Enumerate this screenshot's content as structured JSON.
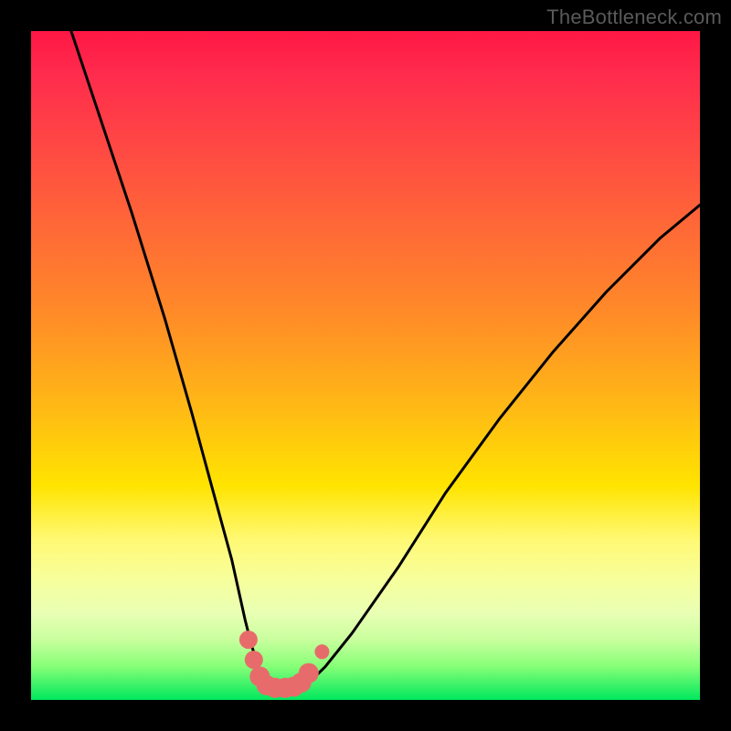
{
  "watermark": "TheBottleneck.com",
  "colors": {
    "frame": "#000000",
    "curve": "#000000",
    "marker": "#e86b6b",
    "gradient_stops": [
      "#ff1744",
      "#ff2a4d",
      "#ff4a43",
      "#ff6a36",
      "#ff8a28",
      "#ffb816",
      "#ffe400",
      "#fff974",
      "#f7ff9c",
      "#e9ffb4",
      "#c9ff9e",
      "#86ff77",
      "#00e85e"
    ]
  },
  "chart_data": {
    "type": "line",
    "title": "",
    "xlabel": "",
    "ylabel": "",
    "xlim": [
      0,
      100
    ],
    "ylim": [
      0,
      100
    ],
    "series": [
      {
        "name": "bottleneck-curve",
        "x": [
          6,
          10,
          15,
          20,
          24,
          27,
          30,
          32,
          33,
          34,
          35,
          36,
          37,
          38,
          40,
          42,
          44,
          48,
          55,
          62,
          70,
          78,
          86,
          94,
          100
        ],
        "y": [
          100,
          88,
          73,
          57,
          43,
          32,
          21,
          12,
          8,
          5,
          3,
          2,
          2,
          2,
          2,
          3,
          5,
          10,
          20,
          31,
          42,
          52,
          61,
          69,
          74
        ]
      }
    ],
    "markers": {
      "name": "minimum-region",
      "points": [
        {
          "x": 32.5,
          "y": 9
        },
        {
          "x": 33.3,
          "y": 6
        },
        {
          "x": 34.2,
          "y": 3.5
        },
        {
          "x": 35.2,
          "y": 2.2
        },
        {
          "x": 36.5,
          "y": 1.8
        },
        {
          "x": 38.0,
          "y": 1.8
        },
        {
          "x": 39.3,
          "y": 2.0
        },
        {
          "x": 40.4,
          "y": 2.6
        },
        {
          "x": 41.5,
          "y": 4.0
        },
        {
          "x": 43.5,
          "y": 7.2
        }
      ]
    }
  }
}
